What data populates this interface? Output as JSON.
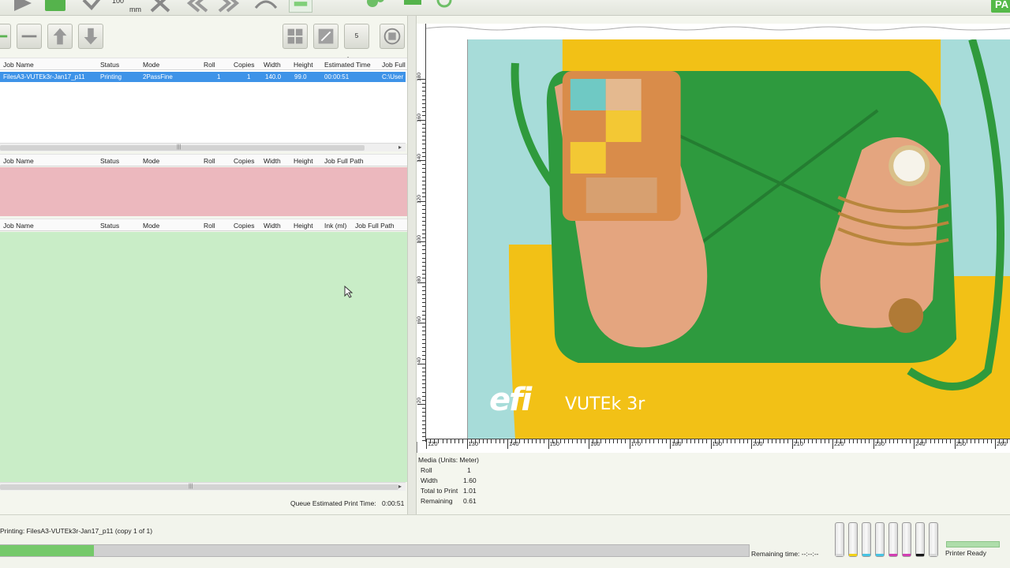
{
  "toolbar": {
    "mm_value": "100",
    "mm_unit": "mm",
    "badge": "PA"
  },
  "left_toolbar": {
    "layers_label": "5 Layers"
  },
  "queue_grid": {
    "columns": [
      "Job Name",
      "Status",
      "Mode",
      "Roll",
      "Copies",
      "Width",
      "Height",
      "Estimated Time",
      "Job Full"
    ],
    "row": {
      "job_name": "FilesA3-VUTEk3r-Jan17_p11",
      "status": "Printing",
      "mode": "2PassFine",
      "roll": "1",
      "copies": "1",
      "width": "140.0",
      "height": "99.0",
      "estimated_time": "00:00:51",
      "job_full": "C:\\User"
    }
  },
  "hold_grid": {
    "columns": [
      "Job Name",
      "Status",
      "Mode",
      "Roll",
      "Copies",
      "Width",
      "Height",
      "Job Full Path"
    ]
  },
  "printed_grid": {
    "columns": [
      "Job Name",
      "Status",
      "Mode",
      "Roll",
      "Copies",
      "Width",
      "Height",
      "Ink (ml)",
      "Job Full Path"
    ]
  },
  "queue_estimate": {
    "label": "Queue Estimated Print Time:",
    "value": "0:00:51"
  },
  "preview": {
    "logo_text": "efi",
    "model_text": "VUTEk 3r",
    "h_ticks": [
      "120",
      "130",
      "140",
      "150",
      "160",
      "170",
      "180",
      "190",
      "200",
      "210",
      "220",
      "230",
      "240",
      "250",
      "260"
    ],
    "v_ticks": [
      "180",
      "160",
      "140",
      "120",
      "100",
      "80",
      "60",
      "40",
      "20"
    ]
  },
  "media": {
    "title": "Media (Units: Meter)",
    "roll_label": "Roll",
    "roll_value": "1",
    "width_label": "Width",
    "width_value": "1.60",
    "total_label": "Total to Print",
    "total_value": "1.01",
    "remaining_label": "Remaining",
    "remaining_value": "0.61"
  },
  "status": {
    "printing_text": "Printing: FilesA3-VUTEk3r-Jan17_p11 (copy 1 of 1)",
    "progress_fraction": 0.125,
    "remaining_time": "Remaining time: --:--:--",
    "printer_state": "Printer Ready"
  },
  "ink_colors": [
    "#d9d9d9",
    "#f2d21a",
    "#49c4e3",
    "#49c4e3",
    "#d23fb3",
    "#d23fb3",
    "#1a1a1a",
    "#d9d9d9"
  ],
  "colors": {
    "selection": "#3e93e8",
    "hold_bg": "#ecb8be",
    "printed_bg": "#c9edc7",
    "progress": "#75c96a"
  }
}
